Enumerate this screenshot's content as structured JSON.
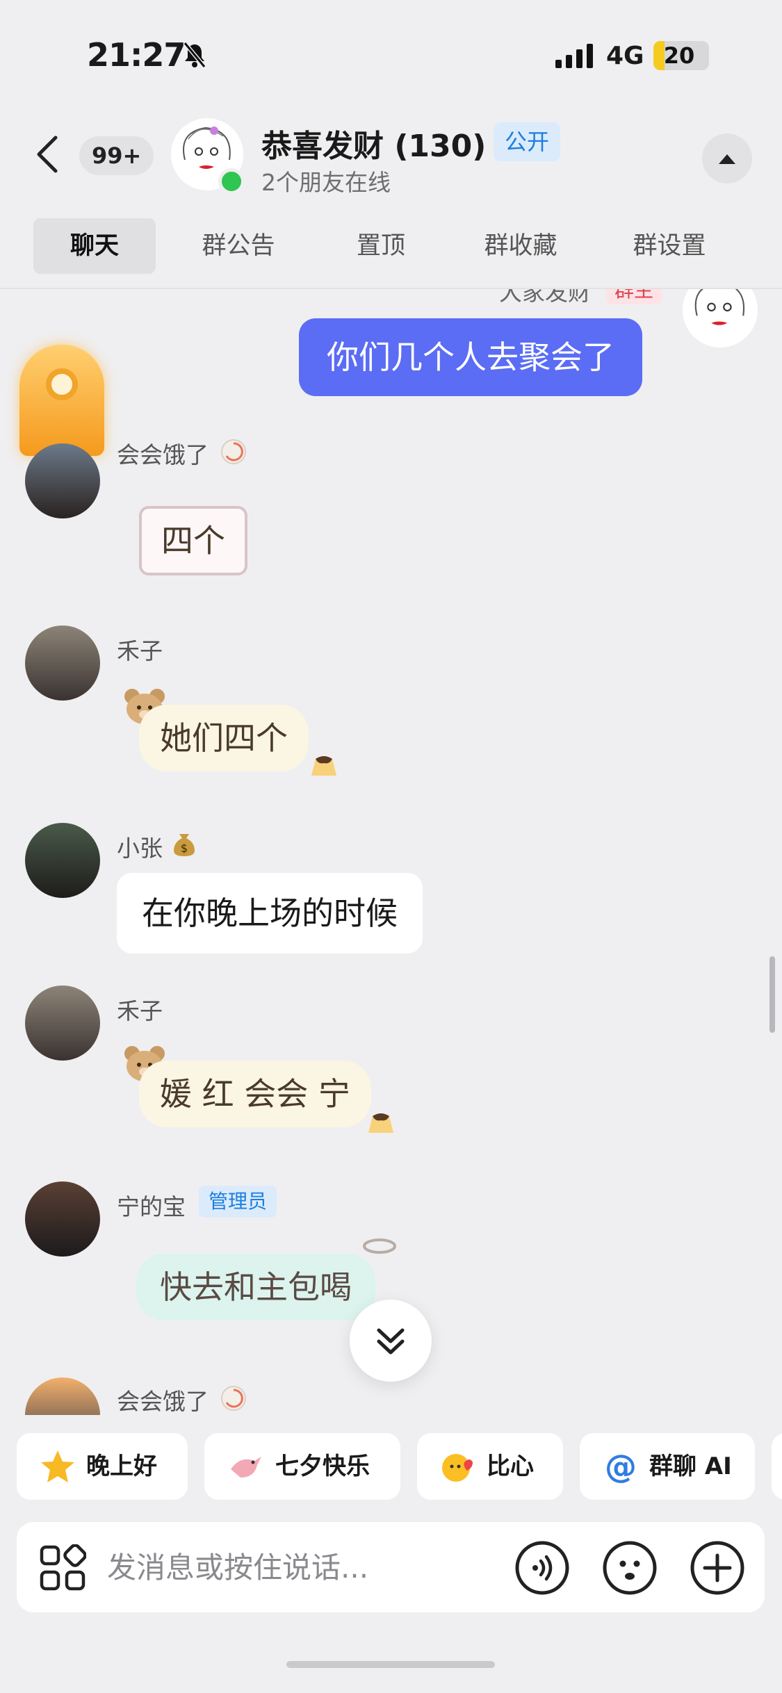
{
  "status_bar": {
    "time": "21:27",
    "network": "4G",
    "battery": "20",
    "battery_level": 0.2
  },
  "header": {
    "unread_count": "99+",
    "group_name": "恭喜发财 (130)",
    "public_tag": "公开",
    "online_status": "2个朋友在线"
  },
  "tabs": [
    "聊天",
    "群公告",
    "置顶",
    "群收藏",
    "群设置"
  ],
  "messages": {
    "top_partial": {
      "sender": "大家发财",
      "role": "群主"
    },
    "m1": {
      "text": "你们几个人去聚会了"
    },
    "m2": {
      "sender": "会会饿了",
      "text": "四个"
    },
    "m3": {
      "sender": "禾子",
      "text": "她们四个"
    },
    "m4": {
      "sender": "小张",
      "text": "在你晚上场的时候"
    },
    "m5": {
      "sender": "禾子",
      "text": "媛 红 会会 宁"
    },
    "m6": {
      "sender": "宁的宝",
      "role": "管理员",
      "text": "快去和主包喝"
    },
    "m7": {
      "sender": "会会饿了"
    }
  },
  "quick_replies": [
    "晚上好",
    "七夕快乐",
    "比心",
    "群聊 AI"
  ],
  "input": {
    "placeholder": "发消息或按住说话..."
  },
  "colors": {
    "accent_blue": "#5b6df4",
    "online_green": "#2ec550",
    "battery_yellow": "#f5cb1f"
  }
}
